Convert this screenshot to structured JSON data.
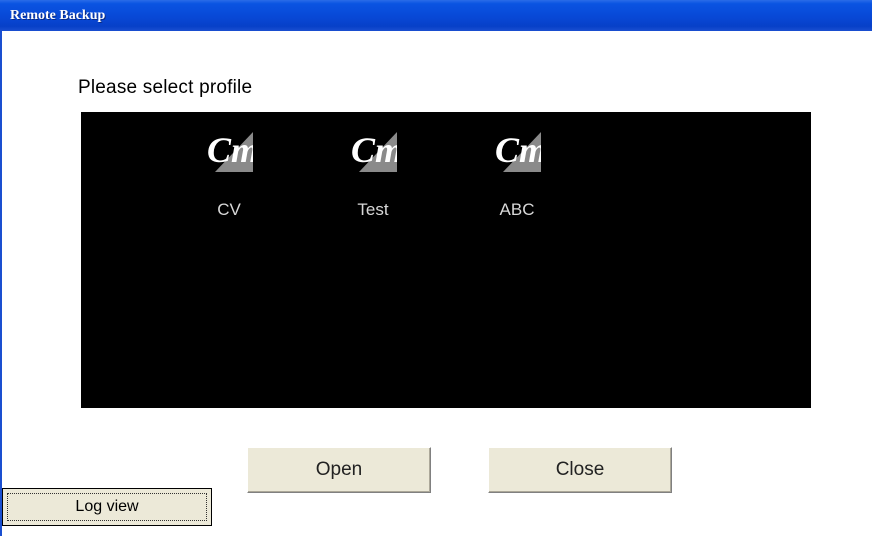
{
  "window": {
    "title": "Remote Backup"
  },
  "heading": "Please select profile",
  "profiles": [
    {
      "label": "CV",
      "icon": "profile-logo-icon"
    },
    {
      "label": "Test",
      "icon": "profile-logo-icon"
    },
    {
      "label": "ABC",
      "icon": "profile-logo-icon"
    }
  ],
  "buttons": {
    "open": "Open",
    "close": "Close",
    "log_view": "Log view"
  },
  "colors": {
    "titlebar": "#0848d6",
    "panel": "#000000",
    "button_face": "#ece9d8"
  }
}
